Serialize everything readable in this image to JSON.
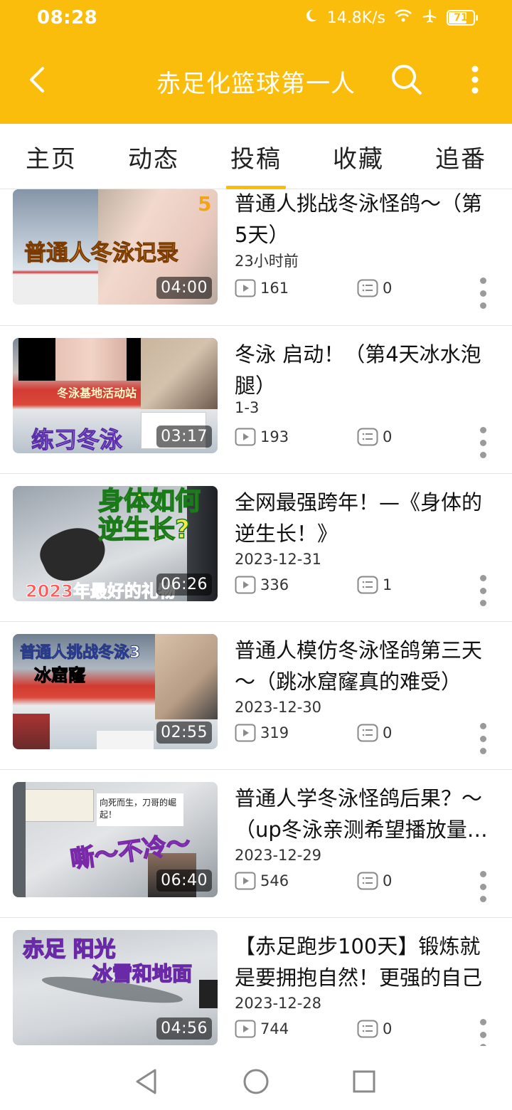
{
  "status_bar": {
    "time": "08:28",
    "network_speed": "14.8K/s",
    "battery": "71",
    "icons": [
      "moon-icon",
      "wifi-icon",
      "airplane-icon",
      "battery-icon"
    ]
  },
  "appbar": {
    "title": "赤足化篮球第一人",
    "icons": [
      "back-arrow-icon",
      "search-icon",
      "more-vertical-icon"
    ]
  },
  "tabs": [
    {
      "label": "主页",
      "active": false
    },
    {
      "label": "动态",
      "active": false
    },
    {
      "label": "投稿",
      "active": true
    },
    {
      "label": "收藏",
      "active": false
    },
    {
      "label": "追番",
      "active": false
    }
  ],
  "colors": {
    "accent": "#fbbd0c",
    "tab_indicator": "#fbbd0c"
  },
  "videos": [
    {
      "title": "普通人挑战冬泳怪鸽～（第5天）",
      "date": "23小时前",
      "views": "161",
      "comments": "0",
      "duration": "04:00",
      "thumb_text": "普通人冬泳记录",
      "thumb_text2": "5"
    },
    {
      "title": "冬泳 启动！（第4天冰水泡腿）",
      "date": "1-3",
      "views": "193",
      "comments": "0",
      "duration": "03:17",
      "thumb_text": "练习冬泳",
      "thumb_text2": "冬泳基地活动站"
    },
    {
      "title": "全网最强跨年！—《身体的逆生长！》",
      "date": "2023-12-31",
      "views": "336",
      "comments": "1",
      "duration": "06:26",
      "thumb_text": "身体如何逆生长?",
      "thumb_text2": "2023年最好的礼物"
    },
    {
      "title": "普通人模仿冬泳怪鸽第三天～（跳冰窟窿真的难受）",
      "date": "2023-12-30",
      "views": "319",
      "comments": "0",
      "duration": "02:55",
      "thumb_text": "普通人挑战冬泳3",
      "thumb_text2": "冰窟窿"
    },
    {
      "title": "普通人学冬泳怪鸽后果？～（up冬泳亲测希望播放量高点）",
      "date": "2023-12-29",
      "views": "546",
      "comments": "0",
      "duration": "06:40",
      "thumb_text": "嘶～不冷～",
      "thumb_text2": "向死而生，刀哥的崛起！"
    },
    {
      "title": "【赤足跑步100天】锻炼就是要拥抱自然！更强的自己",
      "date": "2023-12-28",
      "views": "744",
      "comments": "0",
      "duration": "04:56",
      "thumb_text": "赤足 阳光",
      "thumb_text2": "冰雪和地面"
    }
  ],
  "navbar": {
    "icons": [
      "back-triangle-icon",
      "home-circle-icon",
      "recents-square-icon"
    ]
  }
}
